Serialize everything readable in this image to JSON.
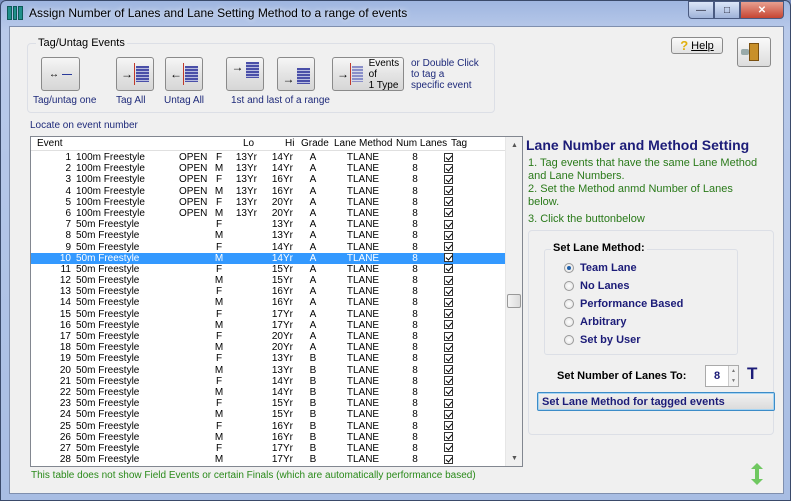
{
  "window": {
    "title": "Assign Number of Lanes and Lane Setting Method to a range of events",
    "minimize": "—",
    "maximize": "□",
    "close": "✕"
  },
  "tag_group": {
    "label": "Tag/Untag Events",
    "buttons": [
      {
        "name": "tag-untag-one",
        "caption": "Tag/untag one"
      },
      {
        "name": "tag-all",
        "caption": "Tag All"
      },
      {
        "name": "untag-all",
        "caption": "Untag All"
      },
      {
        "name": "first-of-range",
        "caption": "1st and last of a range"
      },
      {
        "name": "last-of-range",
        "caption": ""
      },
      {
        "name": "events-of-type",
        "caption": "Events of\n1 Type"
      }
    ],
    "range_caption": "1st and last of a range",
    "events_type_label_line1": "Events of",
    "events_type_label_line2": "1 Type",
    "hint": "or Double Click to tag a specific event",
    "hint_line1": "or Double Click",
    "hint_line2": "to tag a",
    "hint_line3": "specific event"
  },
  "toolbar": {
    "help_label": "Help",
    "help_underline": "H"
  },
  "locate_label": "Locate on event number",
  "grid": {
    "columns": {
      "event": "Event",
      "lo": "Lo",
      "hi": "Hi",
      "grade": "Grade",
      "method": "Lane Method",
      "lanes": "Num Lanes",
      "tag": "Tag"
    },
    "selected_index": 9,
    "rows": [
      {
        "num": "1",
        "name": "100m Freestyle",
        "div": "OPEN",
        "sex": "F",
        "lo": "13Yr",
        "hi": "14Yr",
        "grade": "A",
        "method": "TLANE",
        "lanes": "8",
        "tag": true
      },
      {
        "num": "2",
        "name": "100m Freestyle",
        "div": "OPEN",
        "sex": "M",
        "lo": "13Yr",
        "hi": "14Yr",
        "grade": "A",
        "method": "TLANE",
        "lanes": "8",
        "tag": true
      },
      {
        "num": "3",
        "name": "100m Freestyle",
        "div": "OPEN",
        "sex": "F",
        "lo": "13Yr",
        "hi": "16Yr",
        "grade": "A",
        "method": "TLANE",
        "lanes": "8",
        "tag": true
      },
      {
        "num": "4",
        "name": "100m Freestyle",
        "div": "OPEN",
        "sex": "M",
        "lo": "13Yr",
        "hi": "16Yr",
        "grade": "A",
        "method": "TLANE",
        "lanes": "8",
        "tag": true
      },
      {
        "num": "5",
        "name": "100m Freestyle",
        "div": "OPEN",
        "sex": "F",
        "lo": "13Yr",
        "hi": "20Yr",
        "grade": "A",
        "method": "TLANE",
        "lanes": "8",
        "tag": true
      },
      {
        "num": "6",
        "name": "100m Freestyle",
        "div": "OPEN",
        "sex": "M",
        "lo": "13Yr",
        "hi": "20Yr",
        "grade": "A",
        "method": "TLANE",
        "lanes": "8",
        "tag": true
      },
      {
        "num": "7",
        "name": "50m Freestyle",
        "div": "",
        "sex": "F",
        "lo": "",
        "hi": "13Yr",
        "grade": "A",
        "method": "TLANE",
        "lanes": "8",
        "tag": true
      },
      {
        "num": "8",
        "name": "50m Freestyle",
        "div": "",
        "sex": "M",
        "lo": "",
        "hi": "13Yr",
        "grade": "A",
        "method": "TLANE",
        "lanes": "8",
        "tag": true
      },
      {
        "num": "9",
        "name": "50m Freestyle",
        "div": "",
        "sex": "F",
        "lo": "",
        "hi": "14Yr",
        "grade": "A",
        "method": "TLANE",
        "lanes": "8",
        "tag": true
      },
      {
        "num": "10",
        "name": "50m Freestyle",
        "div": "",
        "sex": "M",
        "lo": "",
        "hi": "14Yr",
        "grade": "A",
        "method": "TLANE",
        "lanes": "8",
        "tag": true
      },
      {
        "num": "11",
        "name": "50m Freestyle",
        "div": "",
        "sex": "F",
        "lo": "",
        "hi": "15Yr",
        "grade": "A",
        "method": "TLANE",
        "lanes": "8",
        "tag": true
      },
      {
        "num": "12",
        "name": "50m Freestyle",
        "div": "",
        "sex": "M",
        "lo": "",
        "hi": "15Yr",
        "grade": "A",
        "method": "TLANE",
        "lanes": "8",
        "tag": true
      },
      {
        "num": "13",
        "name": "50m Freestyle",
        "div": "",
        "sex": "F",
        "lo": "",
        "hi": "16Yr",
        "grade": "A",
        "method": "TLANE",
        "lanes": "8",
        "tag": true
      },
      {
        "num": "14",
        "name": "50m Freestyle",
        "div": "",
        "sex": "M",
        "lo": "",
        "hi": "16Yr",
        "grade": "A",
        "method": "TLANE",
        "lanes": "8",
        "tag": true
      },
      {
        "num": "15",
        "name": "50m Freestyle",
        "div": "",
        "sex": "F",
        "lo": "",
        "hi": "17Yr",
        "grade": "A",
        "method": "TLANE",
        "lanes": "8",
        "tag": true
      },
      {
        "num": "16",
        "name": "50m Freestyle",
        "div": "",
        "sex": "M",
        "lo": "",
        "hi": "17Yr",
        "grade": "A",
        "method": "TLANE",
        "lanes": "8",
        "tag": true
      },
      {
        "num": "17",
        "name": "50m Freestyle",
        "div": "",
        "sex": "F",
        "lo": "",
        "hi": "20Yr",
        "grade": "A",
        "method": "TLANE",
        "lanes": "8",
        "tag": true
      },
      {
        "num": "18",
        "name": "50m Freestyle",
        "div": "",
        "sex": "M",
        "lo": "",
        "hi": "20Yr",
        "grade": "A",
        "method": "TLANE",
        "lanes": "8",
        "tag": true
      },
      {
        "num": "19",
        "name": "50m Freestyle",
        "div": "",
        "sex": "F",
        "lo": "",
        "hi": "13Yr",
        "grade": "B",
        "method": "TLANE",
        "lanes": "8",
        "tag": true
      },
      {
        "num": "20",
        "name": "50m Freestyle",
        "div": "",
        "sex": "M",
        "lo": "",
        "hi": "13Yr",
        "grade": "B",
        "method": "TLANE",
        "lanes": "8",
        "tag": true
      },
      {
        "num": "21",
        "name": "50m Freestyle",
        "div": "",
        "sex": "F",
        "lo": "",
        "hi": "14Yr",
        "grade": "B",
        "method": "TLANE",
        "lanes": "8",
        "tag": true
      },
      {
        "num": "22",
        "name": "50m Freestyle",
        "div": "",
        "sex": "M",
        "lo": "",
        "hi": "14Yr",
        "grade": "B",
        "method": "TLANE",
        "lanes": "8",
        "tag": true
      },
      {
        "num": "23",
        "name": "50m Freestyle",
        "div": "",
        "sex": "F",
        "lo": "",
        "hi": "15Yr",
        "grade": "B",
        "method": "TLANE",
        "lanes": "8",
        "tag": true
      },
      {
        "num": "24",
        "name": "50m Freestyle",
        "div": "",
        "sex": "M",
        "lo": "",
        "hi": "15Yr",
        "grade": "B",
        "method": "TLANE",
        "lanes": "8",
        "tag": true
      },
      {
        "num": "25",
        "name": "50m Freestyle",
        "div": "",
        "sex": "F",
        "lo": "",
        "hi": "16Yr",
        "grade": "B",
        "method": "TLANE",
        "lanes": "8",
        "tag": true
      },
      {
        "num": "26",
        "name": "50m Freestyle",
        "div": "",
        "sex": "M",
        "lo": "",
        "hi": "16Yr",
        "grade": "B",
        "method": "TLANE",
        "lanes": "8",
        "tag": true
      },
      {
        "num": "27",
        "name": "50m Freestyle",
        "div": "",
        "sex": "F",
        "lo": "",
        "hi": "17Yr",
        "grade": "B",
        "method": "TLANE",
        "lanes": "8",
        "tag": true
      },
      {
        "num": "28",
        "name": "50m Freestyle",
        "div": "",
        "sex": "M",
        "lo": "",
        "hi": "17Yr",
        "grade": "B",
        "method": "TLANE",
        "lanes": "8",
        "tag": true
      }
    ]
  },
  "right_panel": {
    "title": "Lane Number and Method Setting",
    "step1": "1. Tag events that have the same Lane Method",
    "step1b": "and Lane Numbers.",
    "step2": "2. Set the Method anmd Number of Lanes",
    "step2b": "below.",
    "step3": "3.  Click the buttonbelow",
    "method_group_label": "Set Lane Method:",
    "methods": [
      {
        "label": "Team Lane",
        "checked": true
      },
      {
        "label": "No Lanes",
        "checked": false
      },
      {
        "label": "Performance Based",
        "checked": false
      },
      {
        "label": "Arbitrary",
        "checked": false
      },
      {
        "label": "Set by User",
        "checked": false
      }
    ],
    "lanes_label": "Set Number of Lanes To:",
    "lanes_value": "8",
    "t_icon": "T",
    "set_button": "Set Lane Method for tagged events"
  },
  "footer_note": "This table does not show Field Events or certain Finals (which are automatically performance based)",
  "colors": {
    "selection": "#3399ff",
    "title_navy": "#1c1c78",
    "instruction_green": "#2a7a1a"
  }
}
